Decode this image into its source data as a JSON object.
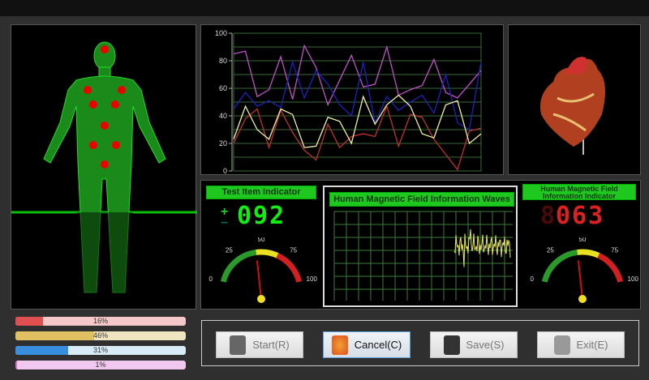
{
  "chart_data": {
    "type": "line",
    "ylim": [
      0,
      100
    ],
    "yticks": [
      "0",
      "20",
      "40",
      "60",
      "80",
      "100"
    ],
    "series": [
      {
        "name": "magenta",
        "color": "#c050c8",
        "values": [
          85,
          87,
          54,
          59,
          83,
          52,
          91,
          75,
          48,
          66,
          84,
          61,
          63,
          90,
          55,
          59,
          62,
          81,
          57,
          53,
          63,
          73
        ]
      },
      {
        "name": "blue",
        "color": "#2020c0",
        "values": [
          45,
          57,
          47,
          51,
          46,
          79,
          53,
          73,
          63,
          48,
          40,
          79,
          35,
          54,
          44,
          50,
          55,
          42,
          70,
          35,
          30,
          79
        ]
      },
      {
        "name": "red",
        "color": "#c03030",
        "values": [
          20,
          38,
          45,
          17,
          44,
          28,
          15,
          8,
          34,
          17,
          25,
          27,
          25,
          47,
          18,
          41,
          39,
          23,
          12,
          1,
          29,
          31
        ]
      },
      {
        "name": "yellow",
        "color": "#f0f0a0",
        "values": [
          23,
          47,
          30,
          23,
          45,
          41,
          17,
          18,
          39,
          36,
          20,
          54,
          34,
          48,
          55,
          47,
          27,
          24,
          48,
          51,
          20,
          27
        ]
      }
    ]
  },
  "test_indicator": {
    "title": "Test Item Indicator",
    "value": "092",
    "plus": "+",
    "minus": "−",
    "gauge": {
      "value": 45,
      "ticks": [
        "0",
        "25",
        "50",
        "75",
        "100"
      ]
    }
  },
  "wave": {
    "title": "Human Magnetic Field Information Waves"
  },
  "field_indicator": {
    "title_line1": "Human Magnetic Field",
    "title_line2": "Information Indicator",
    "value": "063",
    "gauge": {
      "value": 45,
      "ticks": [
        "0",
        "25",
        "50",
        "75",
        "100"
      ]
    }
  },
  "progress": [
    {
      "label": "16%",
      "value": 16,
      "color": "#e05050",
      "bg": "#f4c8c8"
    },
    {
      "label": "46%",
      "value": 46,
      "color": "#e0c060",
      "bg": "#efe4c0"
    },
    {
      "label": "31%",
      "value": 31,
      "color": "#3a8ee0",
      "bg": "#d8ecf8"
    },
    {
      "label": "1%",
      "value": 1,
      "color": "#d070d0",
      "bg": "#f0c8f0"
    }
  ],
  "buttons": {
    "start": "Start(R)",
    "cancel": "Cancel(C)",
    "save": "Save(S)",
    "exit": "Exit(E)"
  }
}
